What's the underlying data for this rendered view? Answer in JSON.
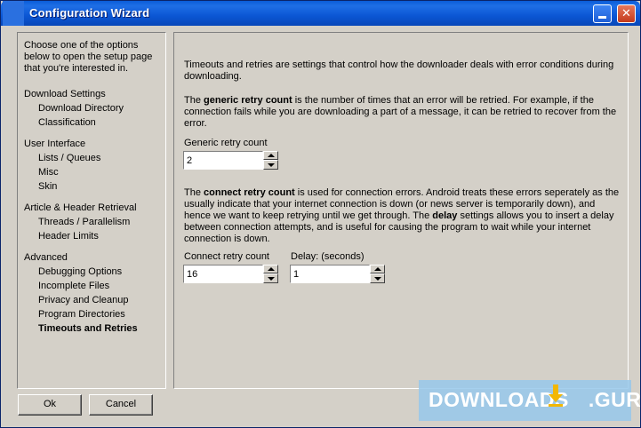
{
  "window": {
    "title": "Configuration Wizard"
  },
  "titlebar_buttons": {
    "minimize": "_",
    "close": "✕"
  },
  "left_panel": {
    "intro": "Choose one of the options below to open the setup page that you're interested in.",
    "groups": [
      {
        "label": "Download Settings",
        "items": [
          "Download Directory",
          "Classification"
        ]
      },
      {
        "label": "User Interface",
        "items": [
          "Lists / Queues",
          "Misc",
          "Skin"
        ]
      },
      {
        "label": "Article & Header Retrieval",
        "items": [
          "Threads / Parallelism",
          "Header Limits"
        ]
      },
      {
        "label": "Advanced",
        "items": [
          "Debugging Options",
          "Incomplete Files",
          "Privacy and Cleanup",
          "Program Directories",
          "Timeouts and Retries"
        ]
      }
    ],
    "active_item": "Timeouts and Retries"
  },
  "main": {
    "intro": "Timeouts and retries are settings that control how the downloader deals with error conditions during downloading.",
    "generic_para_pre": "The ",
    "generic_para_bold": "generic retry count",
    "generic_para_post": " is the number of times that an error will be retried. For example, if the connection fails while you are downloading a part of a message, it can be retried to recover from the error.",
    "generic_label": "Generic retry count",
    "generic_value": "2",
    "connect_para_pre": "The ",
    "connect_para_bold": "connect retry count",
    "connect_para_mid": " is used for connection errors. Android treats these errors seperately as the usually indicate that your internet connection is down (or news server is temporarily down), and hence we want to keep retrying until we get through. The ",
    "connect_para_bold2": "delay",
    "connect_para_post": " settings allows you to insert a delay between connection attempts, and is useful for causing the program to wait while your internet connection is down.",
    "connect_label": "Connect retry count",
    "connect_value": "16",
    "delay_label": "Delay: (seconds)",
    "delay_value": "1"
  },
  "buttons": {
    "ok": "Ok",
    "cancel": "Cancel"
  },
  "watermark": {
    "text_left": "DOWNLOADS",
    "text_right": ".GURU"
  }
}
